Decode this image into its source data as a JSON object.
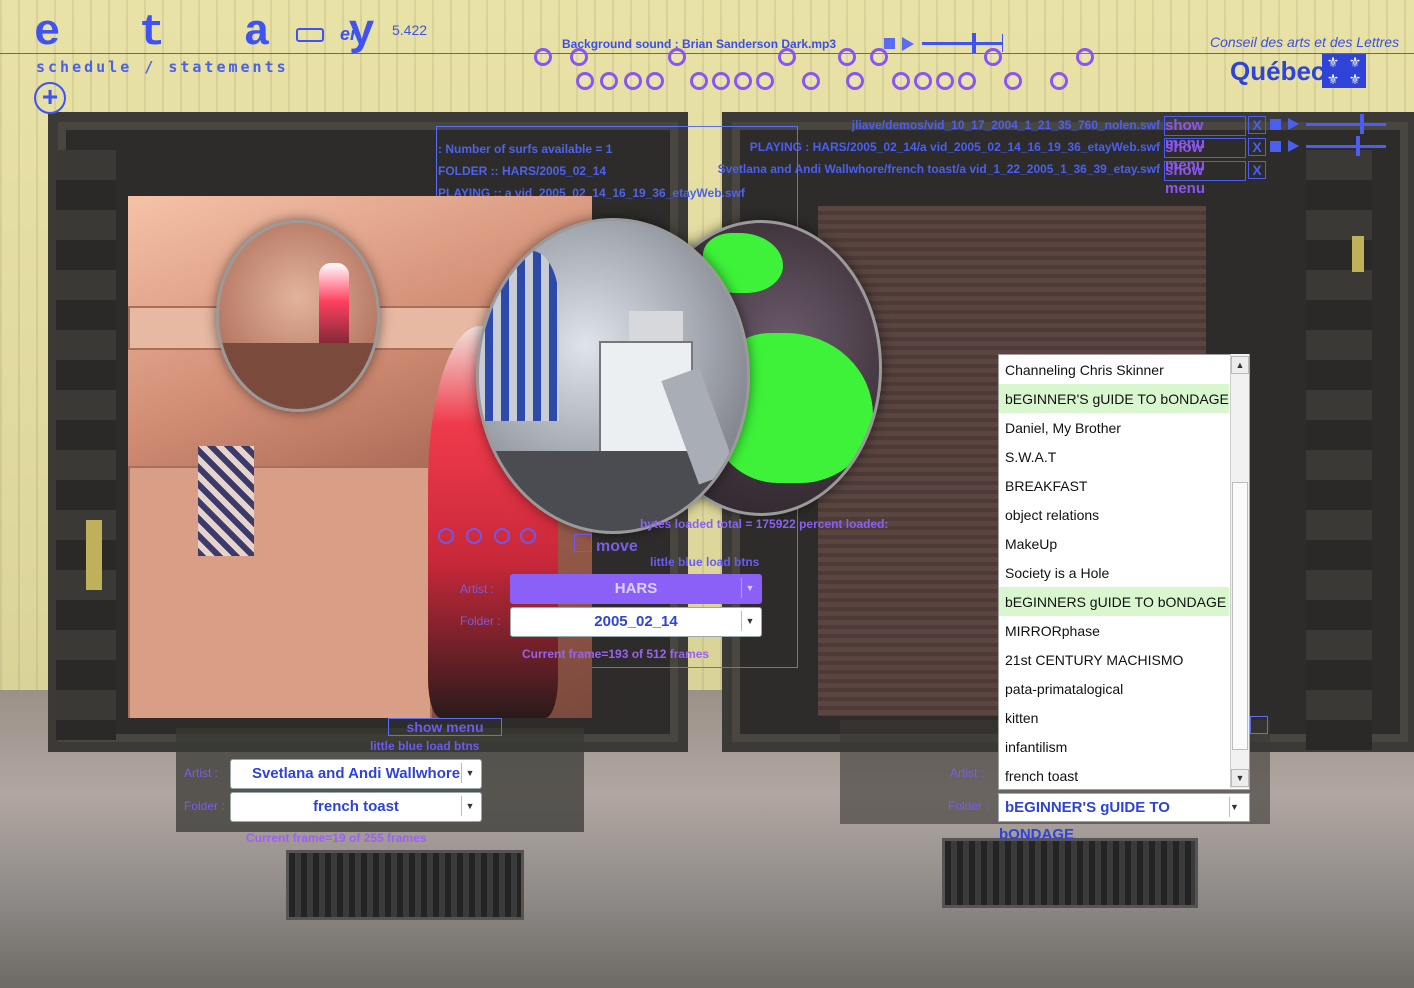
{
  "header": {
    "logo": "e t a y",
    "subtitle": "schedule / statements",
    "plus": "+",
    "mini_logo": "er",
    "version": "5.422",
    "bg_sound": "Background sound : Brian Sanderson   Dark.mp3",
    "conseil": "Conseil des arts et des Lettres",
    "quebec": "Québec",
    "fleur": [
      "⚜",
      "⚜",
      "⚜",
      "⚜"
    ]
  },
  "players": [
    {
      "path": "jliave/demos/vid_10_17_2004_1_21_35_760_nolen.swf",
      "menu": "show menu",
      "close": "X"
    },
    {
      "path": "PLAYING : HARS/2005_02_14/a vid_2005_02_14_16_19_36_etayWeb.swf",
      "menu": "show menu",
      "close": "X"
    },
    {
      "path": "Svetlana and Andi Wallwhore/french toast/a vid_1_22_2005_1_36_39_etay.swf",
      "menu": "show menu",
      "close": "X"
    }
  ],
  "center_info": {
    "surfs": ": Number of surfs available = 1",
    "folder": "FOLDER :: HARS/2005_02_14",
    "playing": "PLAYING :: a vid_2005_02_14_16_19_36_etayWeb.swf",
    "bytes": "bytes loaded total = 175922  percent loaded:",
    "move": "move",
    "little_blue": "little blue load btns"
  },
  "center_controls": {
    "artist_label": "Artist :",
    "artist_value": "HARS",
    "folder_label": "Folder :",
    "folder_value": "2005_02_14",
    "frame": "Current frame=193 of 512 frames"
  },
  "left_controls": {
    "show_menu": "show menu",
    "little_blue": "little blue load btns",
    "artist_label": "Artist :",
    "artist_value": "Svetlana and Andi Wallwhore",
    "folder_label": "Folder :",
    "folder_value": "french toast",
    "frame": "Current frame=19 of 255 frames"
  },
  "right_controls": {
    "artist_label": "Artist :",
    "folder_label": "Folder :",
    "folder_value": "bEGINNER'S gUIDE TO bONDAGE",
    "list": [
      "Channeling Chris Skinner",
      "bEGINNER'S gUIDE TO bONDAGE",
      "Daniel, My Brother",
      "S.W.A.T",
      "BREAKFAST",
      "object relations",
      "MakeUp",
      "Society is a Hole",
      "bEGINNERS gUIDE TO bONDAGE",
      "MIRRORphase",
      "21st  CENTURY  MACHISMO",
      "pata-primatalogical",
      "kitten",
      "infantilism",
      "french toast"
    ]
  },
  "icons": {
    "arrow": "▼",
    "arrow_up": "▲"
  },
  "colors": {
    "accent": "#3f52f2",
    "purple": "#8a55f0",
    "highlight": "#d9f7cf"
  }
}
